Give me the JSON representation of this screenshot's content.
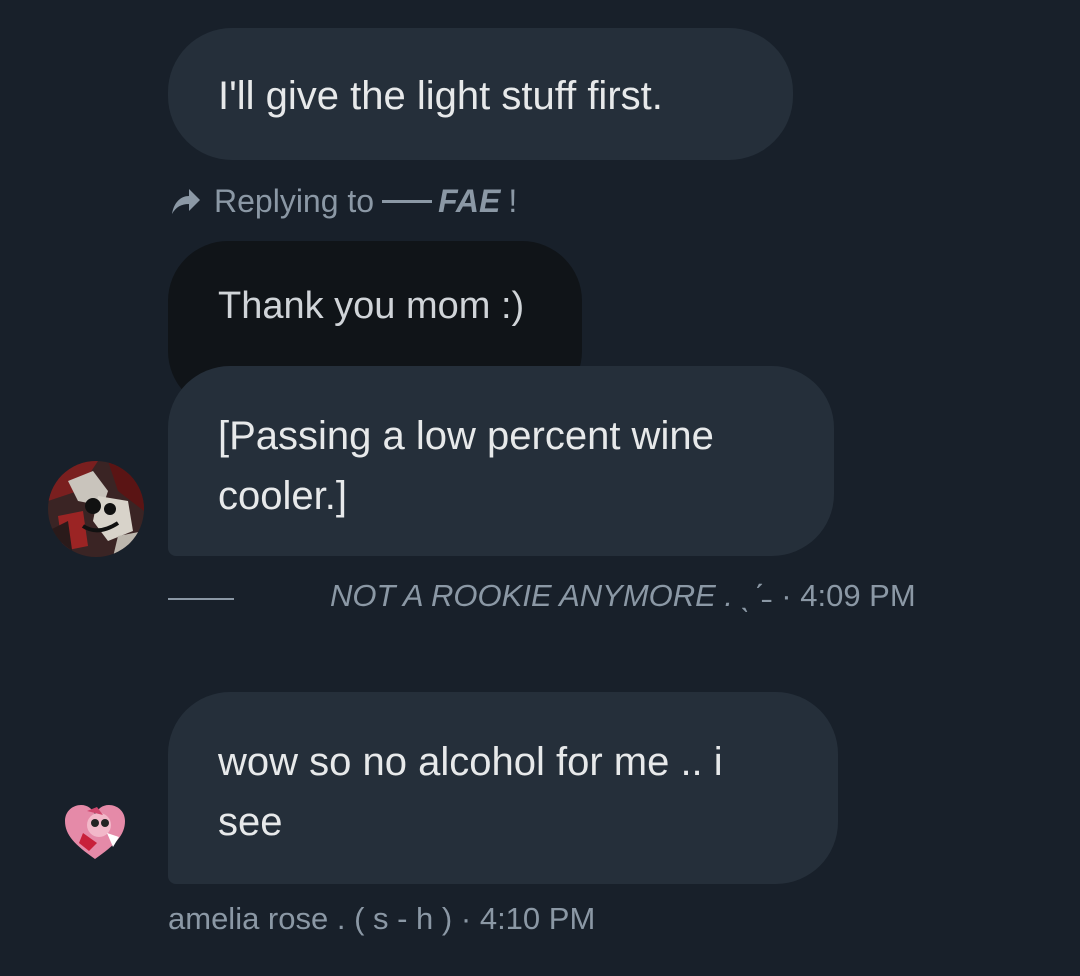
{
  "messages": [
    {
      "text": "I'll give the light stuff first."
    },
    {
      "reply": {
        "prefix": "Replying to",
        "name": "FAE",
        "suffix": "!",
        "quoted_text": "Thank you mom :)"
      },
      "text": "[Passing a low percent wine\ncooler.]",
      "sender": "NOT A ROOKIE ANYMORE . ˎˊ˗",
      "time": "4:09 PM"
    },
    {
      "text": "wow so no alcohol for me .. i\nsee",
      "sender": "amelia rose . ( s - h )",
      "time": "4:10 PM"
    }
  ],
  "separator": "·",
  "colors": {
    "background": "#18202a",
    "bubble": "#252f3a",
    "quoted_bubble": "#101418",
    "text": "#e7e9ea",
    "muted": "#8b98a5"
  },
  "icons": {
    "reply": "reply-arrow-icon"
  }
}
